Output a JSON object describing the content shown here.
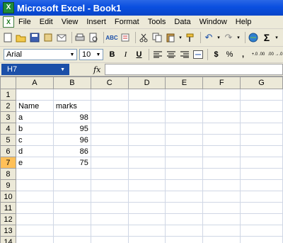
{
  "window": {
    "title": "Microsoft Excel - Book1"
  },
  "menu": [
    "File",
    "Edit",
    "View",
    "Insert",
    "Format",
    "Tools",
    "Data",
    "Window",
    "Help"
  ],
  "toolbar": {
    "icons": [
      "new-document-icon",
      "open-folder-icon",
      "save-icon",
      "permission-icon",
      "email-icon",
      "print-icon",
      "print-preview-icon",
      "spelling-icon",
      "research-icon",
      "cut-icon",
      "copy-icon",
      "paste-icon",
      "format-painter-icon",
      "undo-icon",
      "redo-icon",
      "hyperlink-icon",
      "autosum-icon"
    ],
    "autosum_label": "Σ"
  },
  "format": {
    "font": "Arial",
    "size": "10",
    "bold": "B",
    "italic": "I",
    "underline": "U",
    "currency": "$",
    "percent": "%",
    "comma": ",",
    "increase_decimal": "+.0 .00",
    "decrease_decimal": ".00 →.0"
  },
  "formula": {
    "name_box": "H7",
    "fx_label": "fx",
    "content": ""
  },
  "grid": {
    "columns": [
      "A",
      "B",
      "C",
      "D",
      "E",
      "F",
      "G"
    ],
    "rows": [
      {
        "row": "1",
        "a": "",
        "b": ""
      },
      {
        "row": "2",
        "a": "Name",
        "b": "marks"
      },
      {
        "row": "3",
        "a": "a",
        "b": "98"
      },
      {
        "row": "4",
        "a": "b",
        "b": "95"
      },
      {
        "row": "5",
        "a": "c",
        "b": "96"
      },
      {
        "row": "6",
        "a": "d",
        "b": "86"
      },
      {
        "row": "7",
        "a": "e",
        "b": "75"
      },
      {
        "row": "8",
        "a": "",
        "b": ""
      },
      {
        "row": "9",
        "a": "",
        "b": ""
      },
      {
        "row": "10",
        "a": "",
        "b": ""
      },
      {
        "row": "11",
        "a": "",
        "b": ""
      },
      {
        "row": "12",
        "a": "",
        "b": ""
      },
      {
        "row": "13",
        "a": "",
        "b": ""
      },
      {
        "row": "14",
        "a": "",
        "b": ""
      }
    ],
    "selected_row": "7",
    "selected_column": "H"
  }
}
